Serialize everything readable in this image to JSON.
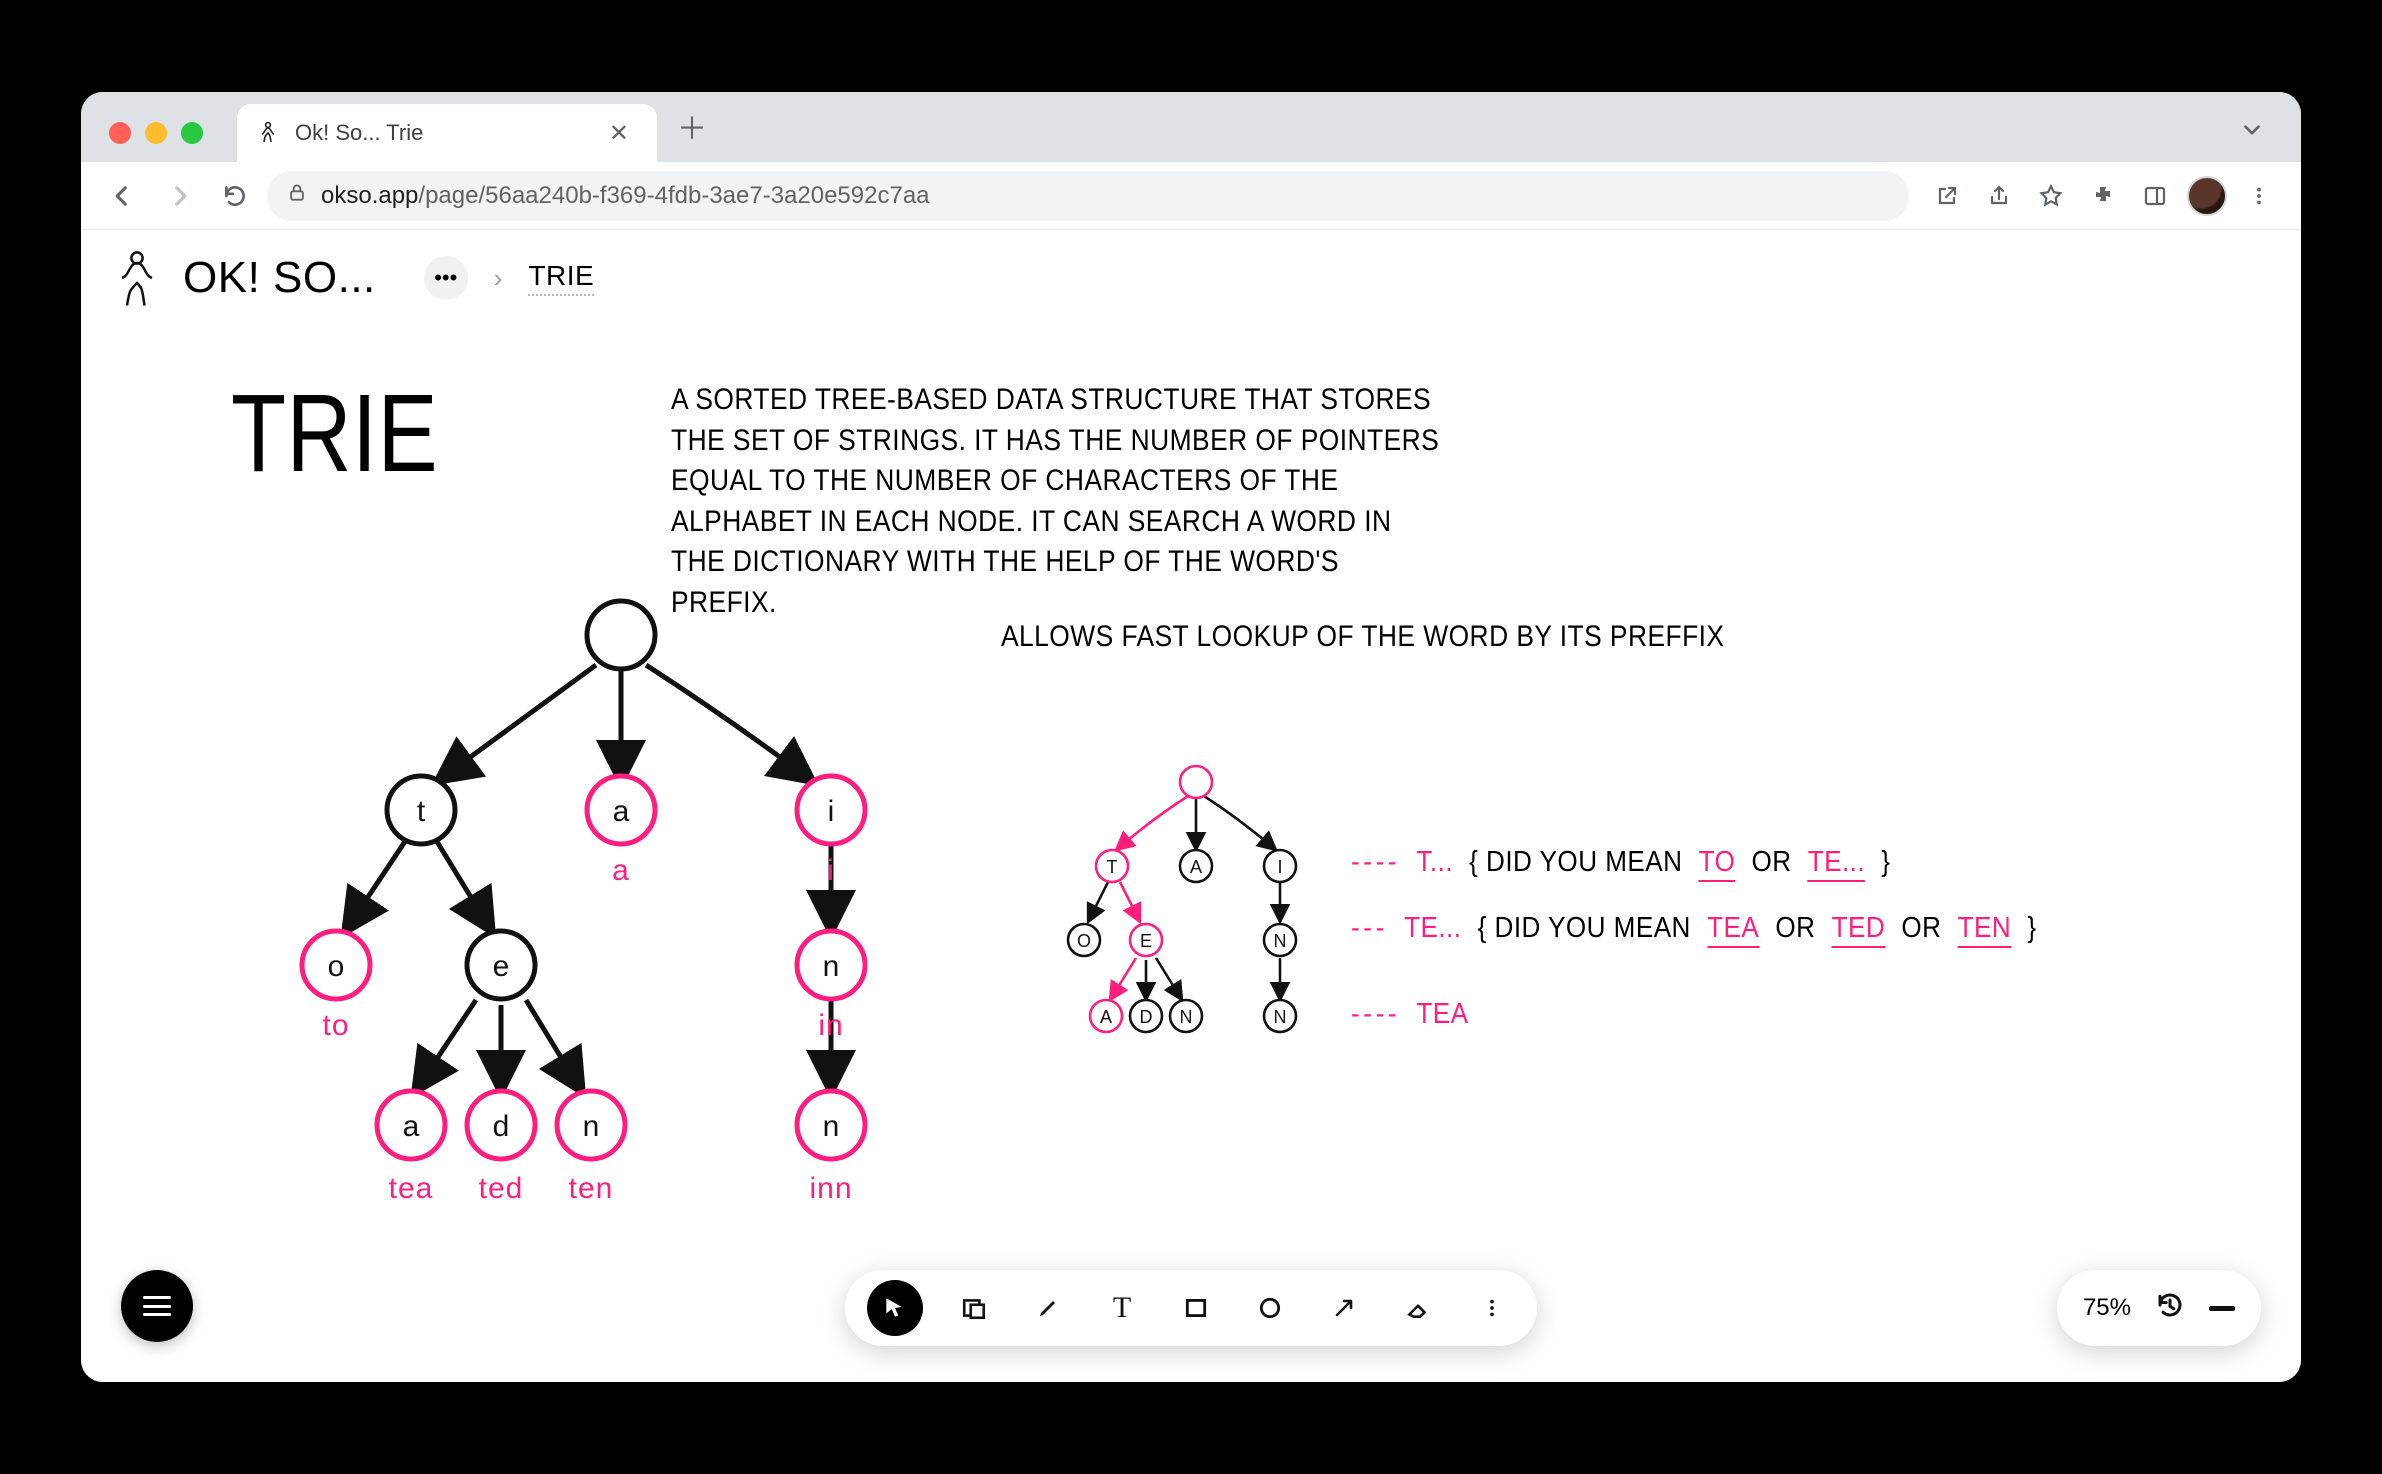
{
  "browser": {
    "tab_title": "Ok! So... Trie",
    "url_host": "okso.app",
    "url_path": "/page/56aa240b-f369-4fdb-3ae7-3a20e592c7aa"
  },
  "header": {
    "app_name": "Ok! So...",
    "breadcrumb_current": "Trie"
  },
  "canvas": {
    "title": "Trie",
    "description": "a sorted tree-based data structure that stores the set of strings. It has the number of pointers equal to the number of characters of the alphabet in each node. It can search a word in the dictionary with the help of the word's prefix.",
    "subtitle": "Allows fast lookup of the word by its preffix",
    "main_tree": {
      "nodes": [
        {
          "id": "root",
          "label": "",
          "terminal": false
        },
        {
          "id": "t",
          "label": "t",
          "terminal": false
        },
        {
          "id": "a",
          "label": "a",
          "terminal": true,
          "word": "a"
        },
        {
          "id": "i",
          "label": "i",
          "terminal": true,
          "word": "i"
        },
        {
          "id": "to",
          "label": "o",
          "terminal": true,
          "word": "to"
        },
        {
          "id": "te",
          "label": "e",
          "terminal": false
        },
        {
          "id": "in",
          "label": "n",
          "terminal": true,
          "word": "in"
        },
        {
          "id": "tea",
          "label": "a",
          "terminal": true,
          "word": "tea"
        },
        {
          "id": "ted",
          "label": "d",
          "terminal": true,
          "word": "ted"
        },
        {
          "id": "ten",
          "label": "n",
          "terminal": true,
          "word": "ten"
        },
        {
          "id": "inn",
          "label": "n",
          "terminal": true,
          "word": "inn"
        }
      ],
      "edges": [
        [
          "root",
          "t"
        ],
        [
          "root",
          "a"
        ],
        [
          "root",
          "i"
        ],
        [
          "t",
          "to"
        ],
        [
          "t",
          "te"
        ],
        [
          "i",
          "in"
        ],
        [
          "te",
          "tea"
        ],
        [
          "te",
          "ted"
        ],
        [
          "te",
          "ten"
        ],
        [
          "in",
          "inn"
        ]
      ]
    },
    "small_tree": {
      "highlight_path": [
        "root",
        "t",
        "te",
        "tea"
      ],
      "nodes": [
        "root",
        "t",
        "a",
        "i",
        "to",
        "te",
        "in",
        "tea",
        "ted",
        "ten",
        "inn"
      ]
    },
    "explanations": [
      {
        "dash": "----",
        "key": "T...",
        "text": "{ did you mean",
        "sugg": [
          "to",
          "te..."
        ],
        "tail": "}"
      },
      {
        "dash": "---",
        "key": "TE...",
        "text": "{ did you mean",
        "sugg": [
          "tea",
          "ted",
          "ten"
        ],
        "tail": "}"
      },
      {
        "dash": "----",
        "key": "TEA",
        "text": "",
        "sugg": [],
        "tail": ""
      }
    ]
  },
  "toolbar": {
    "tools": [
      {
        "name": "pointer-tool",
        "active": true
      },
      {
        "name": "frame-tool"
      },
      {
        "name": "pencil-tool"
      },
      {
        "name": "text-tool"
      },
      {
        "name": "rect-tool"
      },
      {
        "name": "circle-tool"
      },
      {
        "name": "arrow-tool"
      },
      {
        "name": "eraser-tool"
      },
      {
        "name": "more-tool"
      }
    ],
    "zoom_label": "75%"
  },
  "labels": {
    "or": "or"
  }
}
